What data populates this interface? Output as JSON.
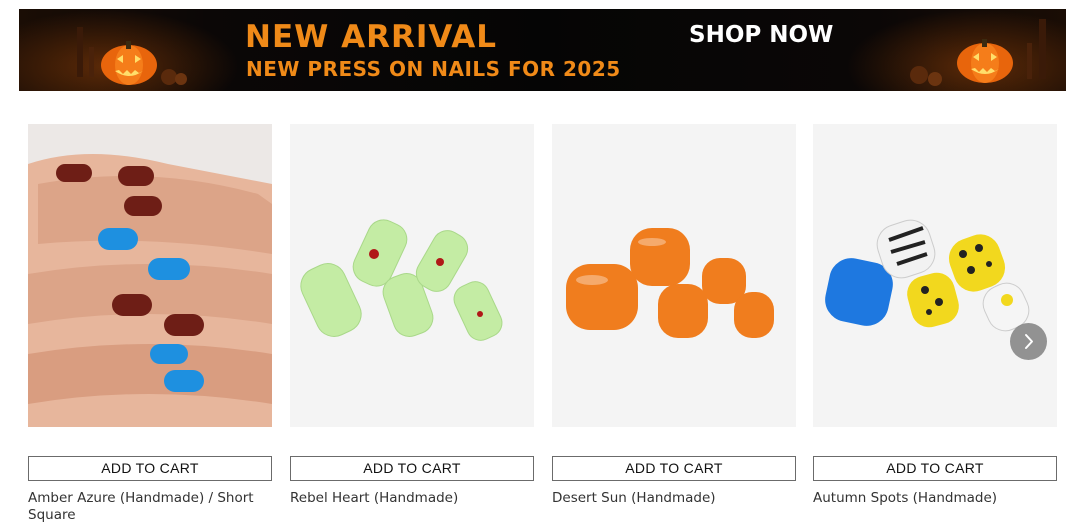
{
  "banner": {
    "headline": "NEW ARRIVAL",
    "subheadline": "NEW PRESS ON NAILS FOR 2025",
    "cta": "SHOP NOW",
    "accent_color": "#f08a18",
    "background_color": "#050505"
  },
  "products": [
    {
      "name": "Amber Azure (Handmade) / Short Square",
      "button": "ADD TO CART"
    },
    {
      "name": "Rebel Heart (Handmade)",
      "button": "ADD TO CART"
    },
    {
      "name": "Desert Sun (Handmade)",
      "button": "ADD TO CART"
    },
    {
      "name": "Autumn Spots (Handmade)",
      "button": "ADD TO CART"
    }
  ],
  "carousel": {
    "next_icon": "chevron-right-icon"
  }
}
